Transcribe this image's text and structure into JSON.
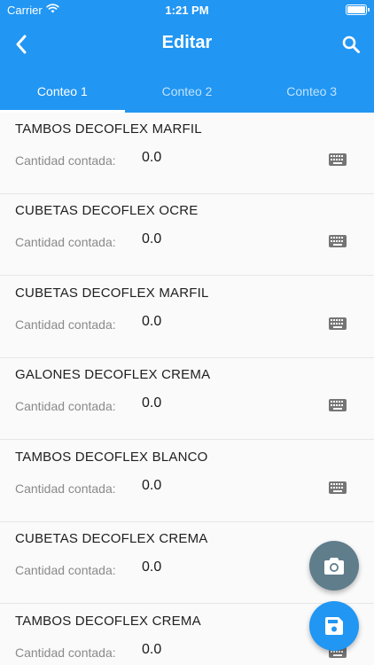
{
  "status_bar": {
    "carrier": "Carrier",
    "time": "1:21 PM"
  },
  "app_bar": {
    "title": "Editar",
    "back_icon": "chevron-left-icon",
    "search_icon": "search-icon"
  },
  "tabs": [
    {
      "label": "Conteo 1",
      "active": true
    },
    {
      "label": "Conteo 2",
      "active": false
    },
    {
      "label": "Conteo 3",
      "active": false
    }
  ],
  "items": [
    {
      "name": "TAMBOS DECOFLEX MARFIL",
      "qty_label": "Cantidad contada:",
      "qty": "0.0"
    },
    {
      "name": "CUBETAS DECOFLEX OCRE",
      "qty_label": "Cantidad contada:",
      "qty": "0.0"
    },
    {
      "name": "CUBETAS DECOFLEX MARFIL",
      "qty_label": "Cantidad contada:",
      "qty": "0.0"
    },
    {
      "name": "GALONES DECOFLEX CREMA",
      "qty_label": "Cantidad contada:",
      "qty": "0.0"
    },
    {
      "name": "TAMBOS DECOFLEX BLANCO",
      "qty_label": "Cantidad contada:",
      "qty": "0.0"
    },
    {
      "name": "CUBETAS DECOFLEX CREMA",
      "qty_label": "Cantidad contada:",
      "qty": "0.0"
    },
    {
      "name": "TAMBOS DECOFLEX CREMA",
      "qty_label": "Cantidad contada:",
      "qty": "0.0"
    }
  ],
  "fabs": {
    "camera_icon": "camera-icon",
    "save_icon": "save-icon"
  },
  "colors": {
    "primary": "#2196f3",
    "camera_fab": "#607d8b",
    "keyboard_icon": "#757575"
  }
}
